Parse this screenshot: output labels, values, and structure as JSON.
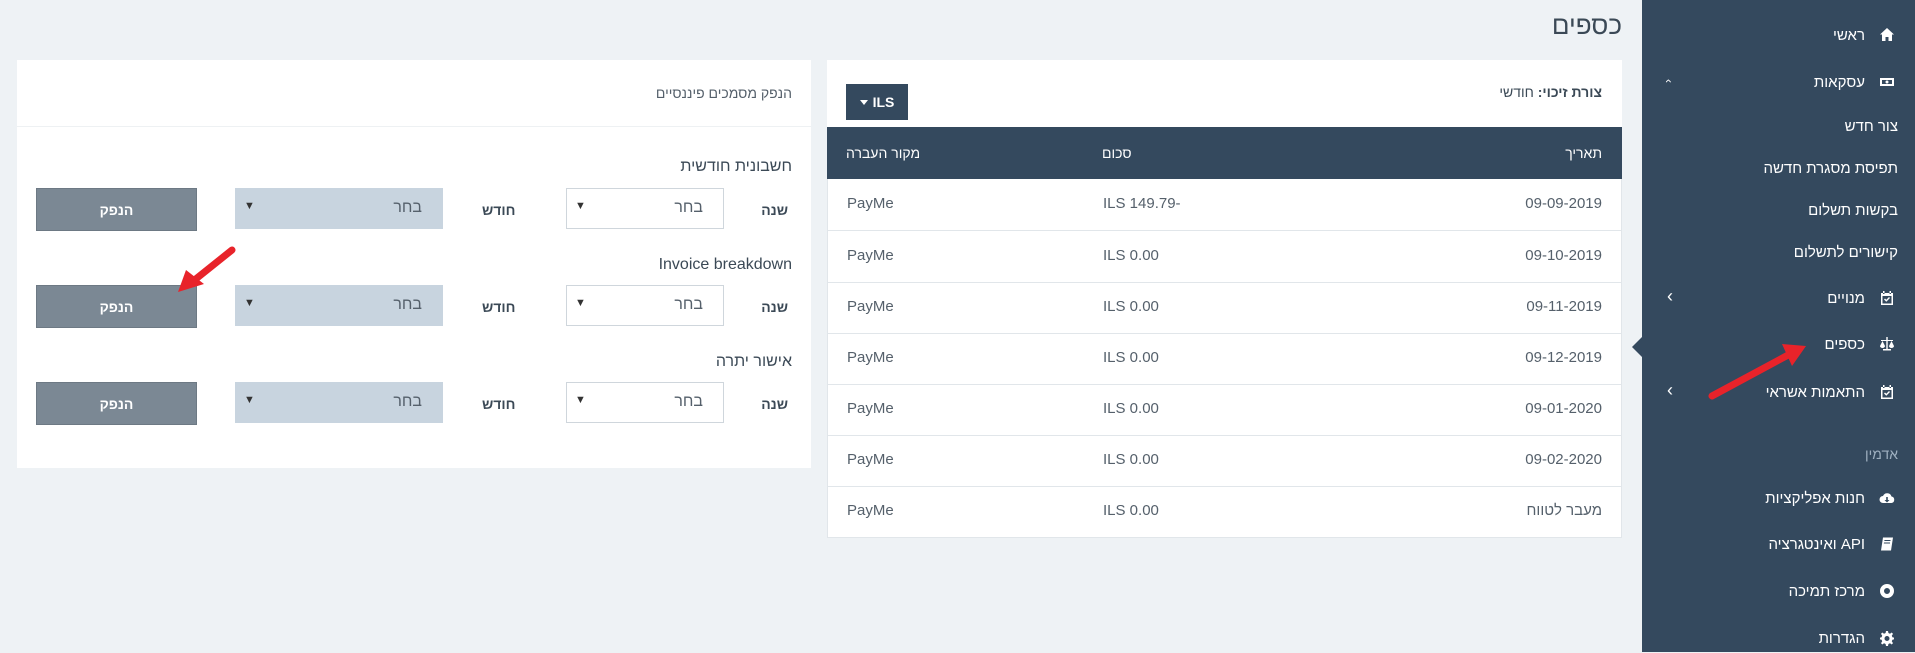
{
  "page_title": "כספים",
  "sidebar": {
    "home": "ראשי",
    "deals": "עסקאות",
    "deals_sub": [
      "צור חדש",
      "תפיסת מסגרת חדשה",
      "בקשות תשלום",
      "קישורים לתשלום"
    ],
    "subscriptions": "מנויים",
    "finance": "כספים",
    "credit_matching": "התאמות אשראי",
    "admin_section": "אדמין",
    "app_store": "חנות אפליקציות",
    "api": "API ואינטגרציה",
    "support": "מרכז תמיכה",
    "settings": "הגדרות"
  },
  "transactions": {
    "credit_label": "צורת זיכוי:",
    "credit_value": "חודשי",
    "currency_button": "ILS",
    "columns": {
      "date": "תאריך",
      "amount": "סכום",
      "source": "מקור העברה"
    },
    "rows": [
      {
        "date": "09-09-2019",
        "amount": "ILS 149.79-",
        "source": "PayMe"
      },
      {
        "date": "09-10-2019",
        "amount": "ILS 0.00",
        "source": "PayMe"
      },
      {
        "date": "09-11-2019",
        "amount": "ILS 0.00",
        "source": "PayMe"
      },
      {
        "date": "09-12-2019",
        "amount": "ILS 0.00",
        "source": "PayMe"
      },
      {
        "date": "09-01-2020",
        "amount": "ILS 0.00",
        "source": "PayMe"
      },
      {
        "date": "09-02-2020",
        "amount": "ILS 0.00",
        "source": "PayMe"
      },
      {
        "date": "מעבר לטווח",
        "amount": "ILS 0.00",
        "source": "PayMe"
      }
    ]
  },
  "documents": {
    "header": "הנפק מסמכים פיננסיים",
    "year_label": "שנה",
    "month_label": "חודש",
    "select_placeholder": "בחר",
    "generate_label": "הנפק",
    "sections": [
      "חשבונית חודשית",
      "Invoice breakdown",
      "אישור יתרה"
    ]
  },
  "colors": {
    "sidebar": "#34495e",
    "annotation_arrow": "#e8232a"
  }
}
